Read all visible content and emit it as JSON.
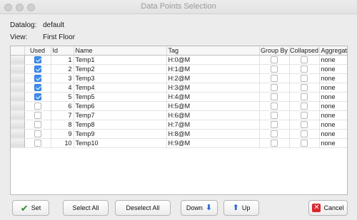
{
  "window": {
    "title": "Data Points Selection"
  },
  "info": {
    "datalog_label": "Datalog:",
    "datalog_value": "default",
    "view_label": "View:",
    "view_value": "First Floor"
  },
  "table": {
    "columns": [
      "",
      "Used",
      "Id",
      "Name",
      "Tag",
      "Group By",
      "Collapsed",
      "Aggregate"
    ],
    "rows": [
      {
        "used": true,
        "id": "1",
        "name": "Temp1",
        "tag": "H:0@M",
        "group_by": false,
        "collapsed": false,
        "aggregate": "none"
      },
      {
        "used": true,
        "id": "2",
        "name": "Temp2",
        "tag": "H:1@M",
        "group_by": false,
        "collapsed": false,
        "aggregate": "none"
      },
      {
        "used": true,
        "id": "3",
        "name": "Temp3",
        "tag": "H:2@M",
        "group_by": false,
        "collapsed": false,
        "aggregate": "none"
      },
      {
        "used": true,
        "id": "4",
        "name": "Temp4",
        "tag": "H:3@M",
        "group_by": false,
        "collapsed": false,
        "aggregate": "none"
      },
      {
        "used": true,
        "id": "5",
        "name": "Temp5",
        "tag": "H:4@M",
        "group_by": false,
        "collapsed": false,
        "aggregate": "none"
      },
      {
        "used": false,
        "id": "6",
        "name": "Temp6",
        "tag": "H:5@M",
        "group_by": false,
        "collapsed": false,
        "aggregate": "none"
      },
      {
        "used": false,
        "id": "7",
        "name": "Temp7",
        "tag": "H:6@M",
        "group_by": false,
        "collapsed": false,
        "aggregate": "none"
      },
      {
        "used": false,
        "id": "8",
        "name": "Temp8",
        "tag": "H:7@M",
        "group_by": false,
        "collapsed": false,
        "aggregate": "none"
      },
      {
        "used": false,
        "id": "9",
        "name": "Temp9",
        "tag": "H:8@M",
        "group_by": false,
        "collapsed": false,
        "aggregate": "none"
      },
      {
        "used": false,
        "id": "10",
        "name": "Temp10",
        "tag": "H:9@M",
        "group_by": false,
        "collapsed": false,
        "aggregate": "none"
      }
    ]
  },
  "buttons": {
    "set": "Set",
    "select_all": "Select All",
    "deselect_all": "Deselect All",
    "down": "Down",
    "up": "Up",
    "cancel": "Cancel"
  },
  "icons": {
    "set": "checkmark-icon",
    "down": "arrow-down-icon",
    "up": "arrow-up-icon",
    "cancel": "cancel-x-icon"
  },
  "colors": {
    "checkbox_checked": "#3d8ef0",
    "arrow_blue": "#2a6bd6",
    "cancel_red": "#d9272e",
    "set_green": "#2e8b2e"
  }
}
